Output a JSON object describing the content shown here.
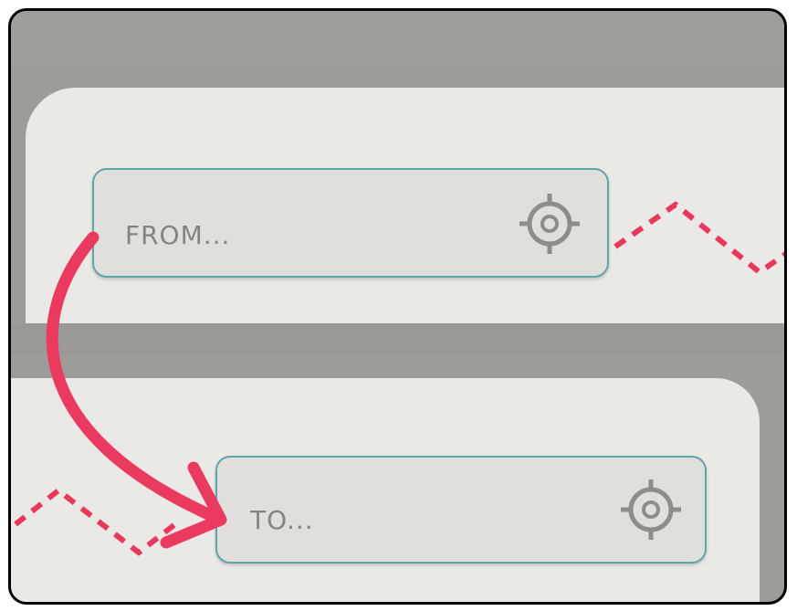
{
  "from_field": {
    "placeholder": "FROM...",
    "icon": "crosshair-icon"
  },
  "to_field": {
    "placeholder": "TO...",
    "icon": "crosshair-icon"
  },
  "colors": {
    "route_dash": "#e8385d",
    "arrow": "#ea3a5f",
    "field_border": "#5fa6a8",
    "field_bg": "#e0dfdc",
    "panel_bg": "#ebe9e6",
    "placeholder_text": "#868482"
  }
}
